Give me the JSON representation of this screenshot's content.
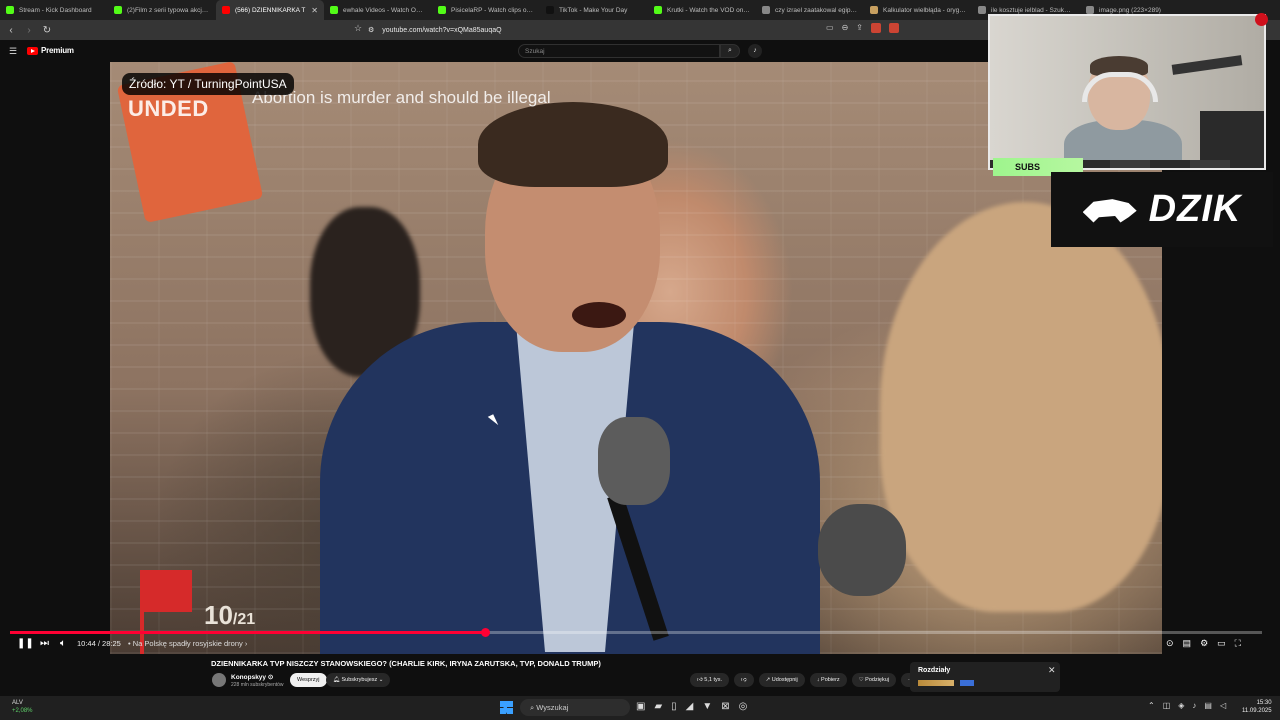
{
  "browser": {
    "tabs": [
      {
        "label": "Stream - Kick Dashboard",
        "color": "#53fc18"
      },
      {
        "label": "(2)Film z serii typowa akcja na",
        "color": "#53fc18"
      },
      {
        "label": "(566) DZIENNIKARKA T",
        "color": "#ff0000",
        "active": true
      },
      {
        "label": "ewhale Videos - Watch On-Dem",
        "color": "#53fc18"
      },
      {
        "label": "PisicelaRP - Watch clips on Ki",
        "color": "#53fc18"
      },
      {
        "label": "TikTok - Make Your Day",
        "color": "#111111"
      },
      {
        "label": "Krutki - Watch the VOD on Ki",
        "color": "#53fc18"
      },
      {
        "label": "czy izrael zaatakowal egipt - S",
        "color": "#888888"
      },
      {
        "label": "Kalkulator wielbłąda - oryginal",
        "color": "#c8a060"
      },
      {
        "label": "ile kosztuje ielblad - Szukaj w",
        "color": "#888888"
      },
      {
        "label": "image.png (223×289)",
        "color": "#888888"
      }
    ],
    "url": "youtube.com/watch?v=xQMa85auqaQ"
  },
  "youtube": {
    "logo": "Premium",
    "search_placeholder": "Szukaj"
  },
  "video": {
    "source_badge": "Źródło: YT / TurningPointUSA",
    "banner_left": "UNDED",
    "banner_text": "Abortion is murder and should be illegal",
    "counter_main": "10",
    "counter_sub": "/21",
    "progress": 0.38
  },
  "overlay": {
    "subs_label": "SUBS",
    "brand": "DZIK"
  },
  "player": {
    "time": "10:44 / 28:25",
    "chapter": "• Na Polskę spadły rosyjskie drony ›"
  },
  "meta": {
    "title": "DZIENNIKARKA TVP NISZCZY STANOWSKIEGO? (CHARLIE KIRK, IRYNA ZARUTSKA, TVP, DONALD TRUMP)",
    "channel": "Konopskyy ⊙",
    "subs": "228 mln subskrybentów",
    "support": "Wesprzyj",
    "subscribed": "Subskrybujesz ⌄",
    "likes": "5,1 tys.",
    "share": "Udostępnij",
    "download": "Pobierz",
    "thanks": "Podziękuj",
    "more": "···",
    "chapters_title": "Rozdziały"
  },
  "taskbar": {
    "weather_label": "ALV",
    "weather_change": "+2,08%",
    "search": "Wyszukaj",
    "time": "15:30",
    "date": "11.09.2025"
  }
}
